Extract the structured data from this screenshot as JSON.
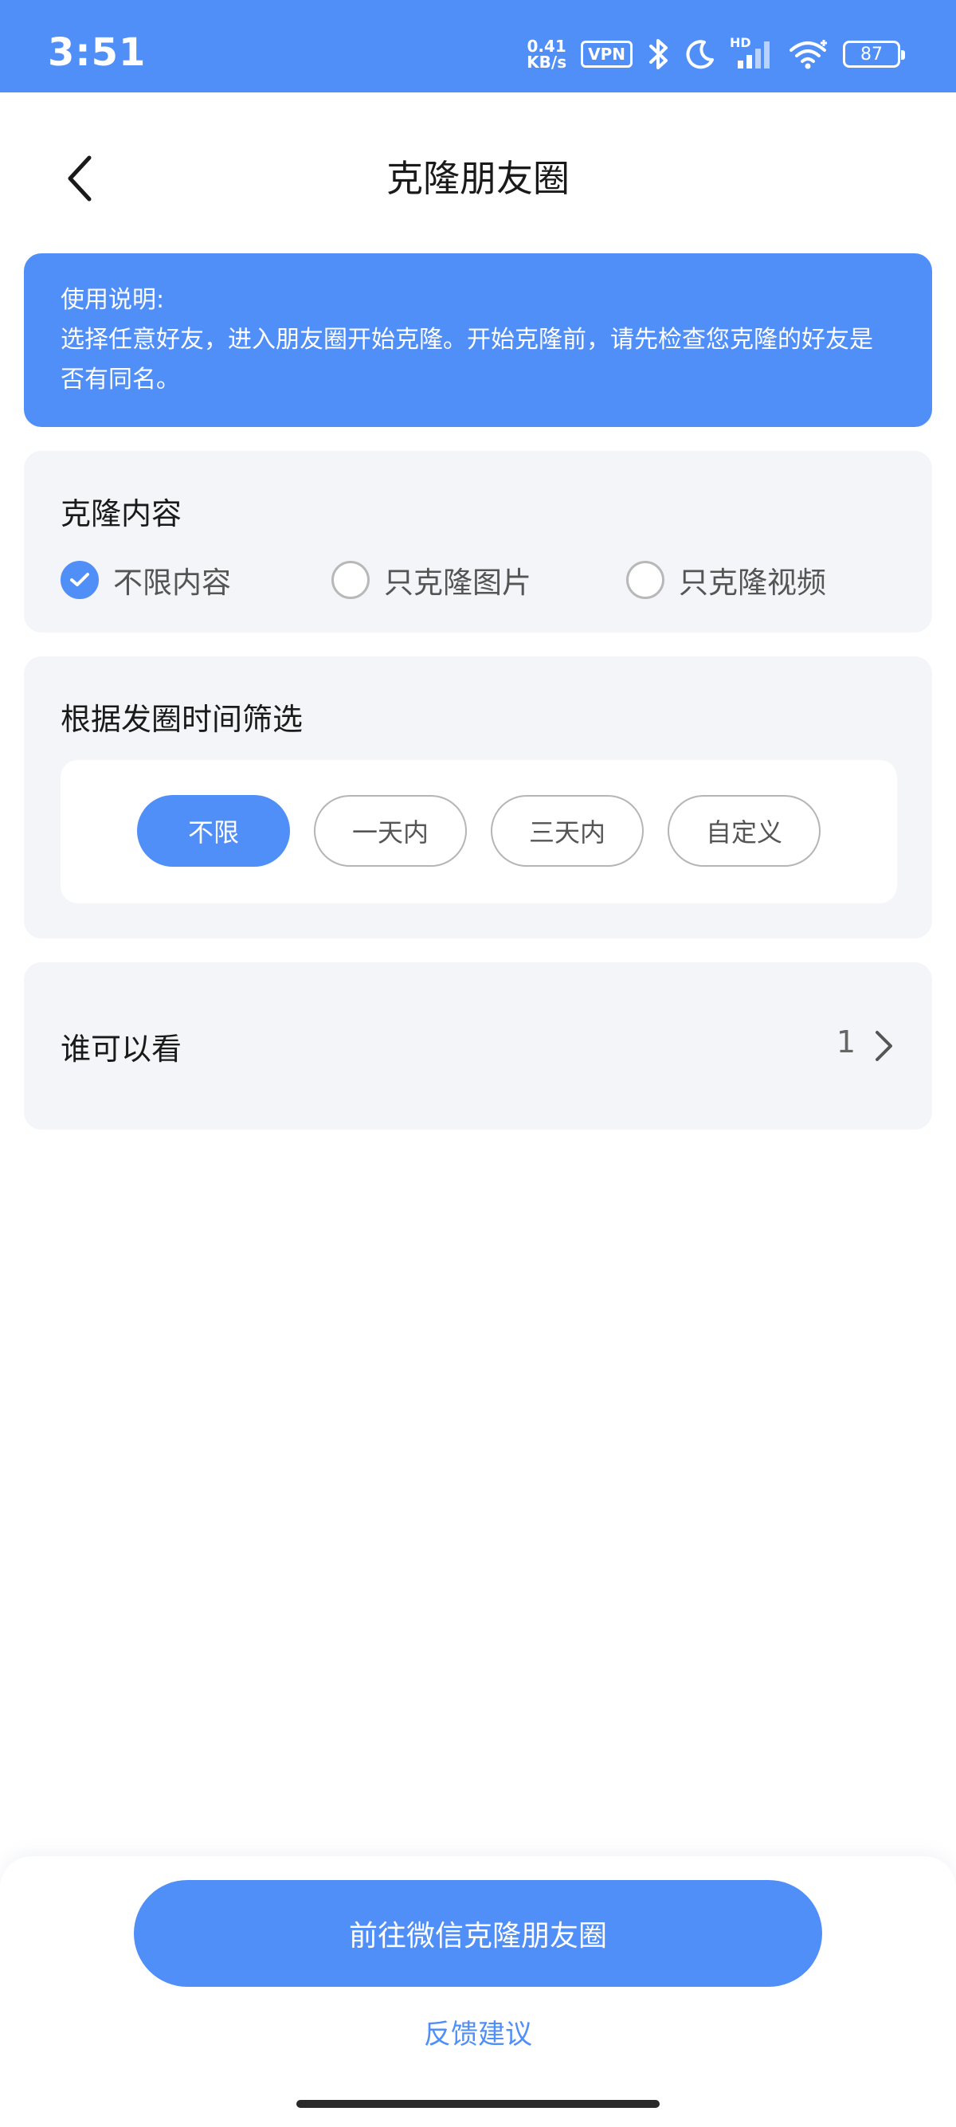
{
  "status_bar": {
    "time": "3:51",
    "net_speed_value": "0.41",
    "net_speed_unit": "KB/s",
    "vpn": "VPN",
    "signal_label": "HD",
    "battery": "87"
  },
  "header": {
    "title": "克隆朋友圈"
  },
  "notice": {
    "heading": "使用说明:",
    "body": "选择任意好友，进入朋友圈开始克隆。开始克隆前，请先检查您克隆的好友是否有同名。"
  },
  "clone_content": {
    "title": "克隆内容",
    "options": [
      "不限内容",
      "只克隆图片",
      "只克隆视频"
    ],
    "selected": "不限内容"
  },
  "time_filter": {
    "title": "根据发圈时间筛选",
    "options": [
      "不限",
      "一天内",
      "三天内",
      "自定义"
    ],
    "selected": "不限"
  },
  "visibility": {
    "title": "谁可以看",
    "value": "1"
  },
  "bottom": {
    "primary_button": "前往微信克隆朋友圈",
    "feedback": "反馈建议"
  },
  "colors": {
    "accent": "#508ef8",
    "card_bg": "#f4f5f8"
  }
}
